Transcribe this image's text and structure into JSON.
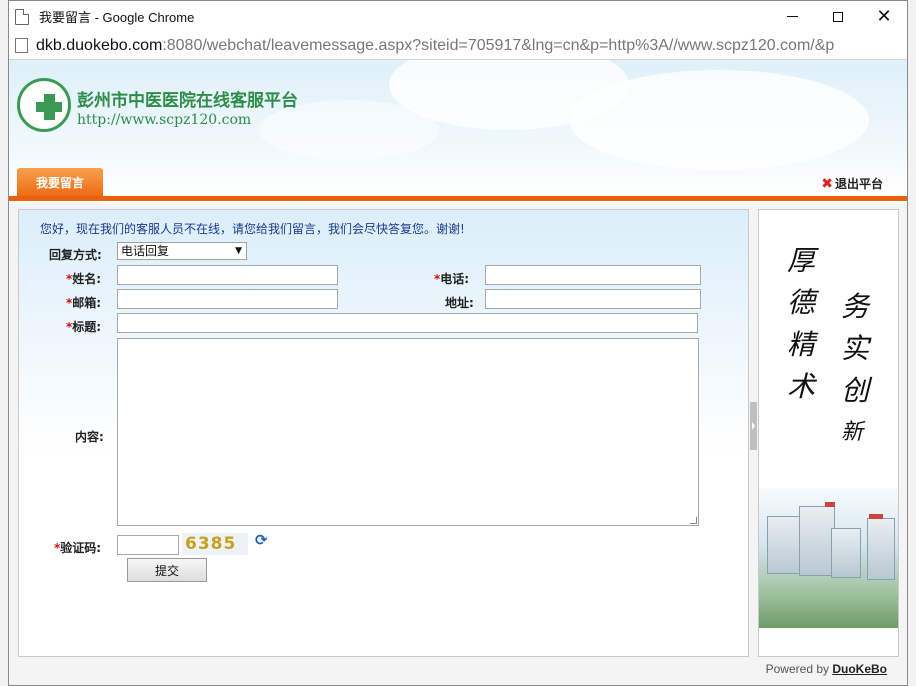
{
  "window": {
    "title": "我要留言 - Google Chrome",
    "url_host": "dkb.duokebo.com",
    "url_rest": ":8080/webchat/leavemessage.aspx?siteid=705917&lng=cn&p=http%3A//www.scpz120.com/&p"
  },
  "header": {
    "hospital_name": "彭州市中医医院在线客服平台",
    "hospital_url": "http://www.scpz120.com",
    "tab_label": "我要留言",
    "exit_label": "退出平台"
  },
  "form": {
    "notice": "您好，现在我们的客服人员不在线，请您给我们留言，我们会尽快答复您。谢谢!",
    "reply_method_label": "回复方式:",
    "reply_method_value": "电话回复",
    "name_label": "姓名:",
    "phone_label": "电话:",
    "email_label": "邮箱:",
    "address_label": "地址:",
    "subject_label": "标题:",
    "content_label": "内容:",
    "captcha_label": "验证码:",
    "captcha_text": "6385",
    "required_mark": "*",
    "submit_label": "提交"
  },
  "side": {
    "col1": [
      "厚",
      "德",
      "精",
      "术"
    ],
    "col2": [
      "务",
      "实",
      "创",
      "新"
    ]
  },
  "footer": {
    "powered_by": "Powered by ",
    "brand": "DuoKeBo"
  },
  "colors": {
    "accent_orange": "#e8620e",
    "brand_green": "#2f8c4a",
    "required_red": "#d01010"
  }
}
